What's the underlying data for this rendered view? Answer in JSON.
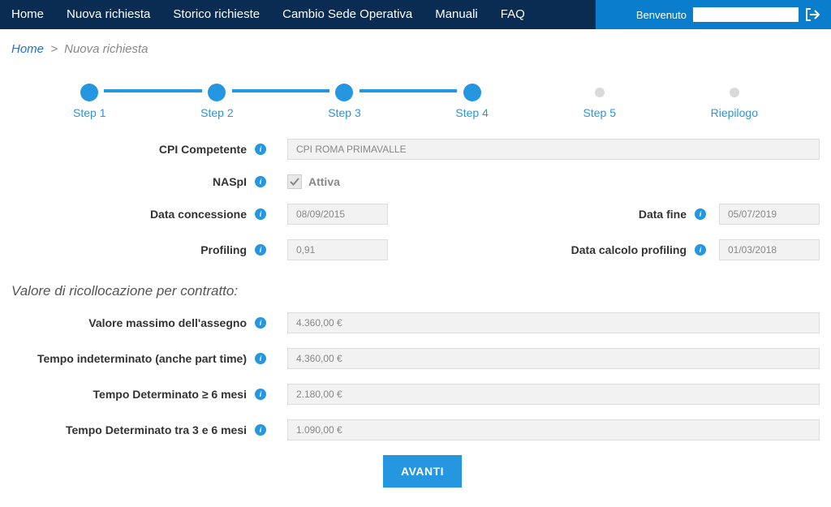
{
  "nav": {
    "items": [
      "Home",
      "Nuova richiesta",
      "Storico richieste",
      "Cambio Sede Operativa",
      "Manuali",
      "FAQ"
    ],
    "welcome": "Benvenuto",
    "user": ""
  },
  "breadcrumb": {
    "home": "Home",
    "current": "Nuova richiesta"
  },
  "stepper": {
    "steps": [
      "Step 1",
      "Step 2",
      "Step 3",
      "Step 4",
      "Step 5",
      "Riepilogo"
    ]
  },
  "form": {
    "cpi_label": "CPI Competente",
    "cpi_value": "CPI ROMA PRIMAVALLE",
    "naspi_label": "NASpI",
    "naspi_checkbox_label": "Attiva",
    "naspi_checked": true,
    "data_concessione_label": "Data concessione",
    "data_concessione_value": "08/09/2015",
    "data_fine_label": "Data fine",
    "data_fine_value": "05/07/2019",
    "profiling_label": "Profiling",
    "profiling_value": "0,91",
    "data_calcolo_profiling_label": "Data calcolo profiling",
    "data_calcolo_profiling_value": "01/03/2018"
  },
  "section_title": "Valore di ricollocazione per contratto:",
  "valori": {
    "valore_massimo_label": "Valore massimo dell'assegno",
    "valore_massimo_value": "4.360,00 €",
    "tempo_indeterminato_label": "Tempo indeterminato (anche part time)",
    "tempo_indeterminato_value": "4.360,00 €",
    "tempo_det_6_label": "Tempo Determinato ≥ 6 mesi",
    "tempo_det_6_value": "2.180,00 €",
    "tempo_det_3_6_label": "Tempo Determinato tra 3 e 6 mesi",
    "tempo_det_3_6_value": "1.090,00 €"
  },
  "buttons": {
    "avanti": "AVANTI"
  }
}
